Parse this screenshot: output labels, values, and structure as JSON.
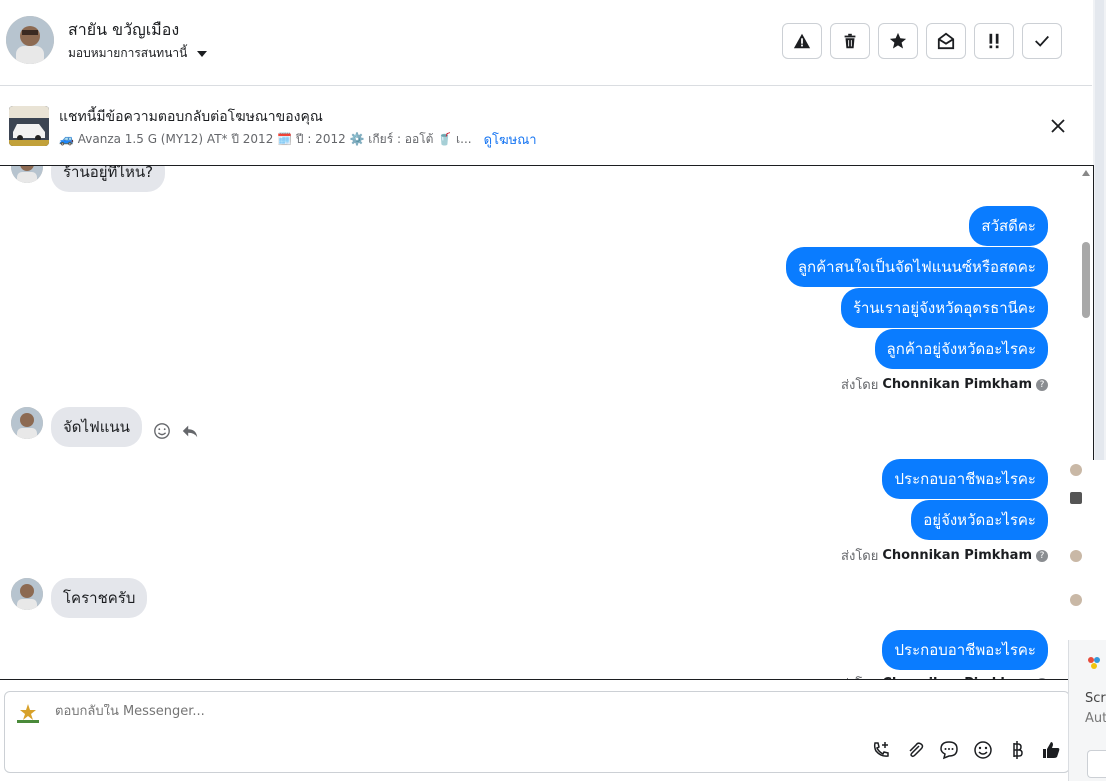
{
  "header": {
    "contact_name": "สายัน ขวัญเมือง",
    "assign_label": "มอบหมายการสนทนานี้"
  },
  "ad": {
    "title": "แชทนี้มีข้อความตอบกลับต่อโฆษณาของคุณ",
    "details": "🚙 Avanza 1.5 G (MY12) AT* ปี 2012 🗓️ ปี : 2012 ⚙️ เกียร์ : ออโต้ 🥤 เ...",
    "link": "ดูโฆษณา"
  },
  "messages": {
    "in_1": "ร้านอยู่ที่ไหน?",
    "out_1": "สวัสดีคะ",
    "out_2": "ลูกค้าสนใจเป็นจัดไฟแนนซ์หรือสดคะ",
    "out_3": "ร้านเราอยู่จังหวัดอุดรธานีคะ",
    "out_4": "ลูกค้าอยู่จังหวัดอะไรคะ",
    "in_2": "จัดไฟแนน",
    "out_5": "ประกอบอาชีพอะไรคะ",
    "out_6": "อยู่จังหวัดอะไรคะ",
    "in_3": "โคราชครับ",
    "out_7": "ประกอบอาชีพอะไรคะ"
  },
  "sent_by": {
    "prefix": "ส่งโดย",
    "agent": "Chonnikan Pimkham"
  },
  "composer": {
    "placeholder": "ตอบกลับใน Messenger..."
  },
  "side_panel": {
    "text_1": "Scre",
    "text_2": "Aut"
  },
  "colors": {
    "outgoing_bubble": "#0a7cff",
    "incoming_bubble": "#e4e6eb",
    "link": "#1876f2"
  }
}
